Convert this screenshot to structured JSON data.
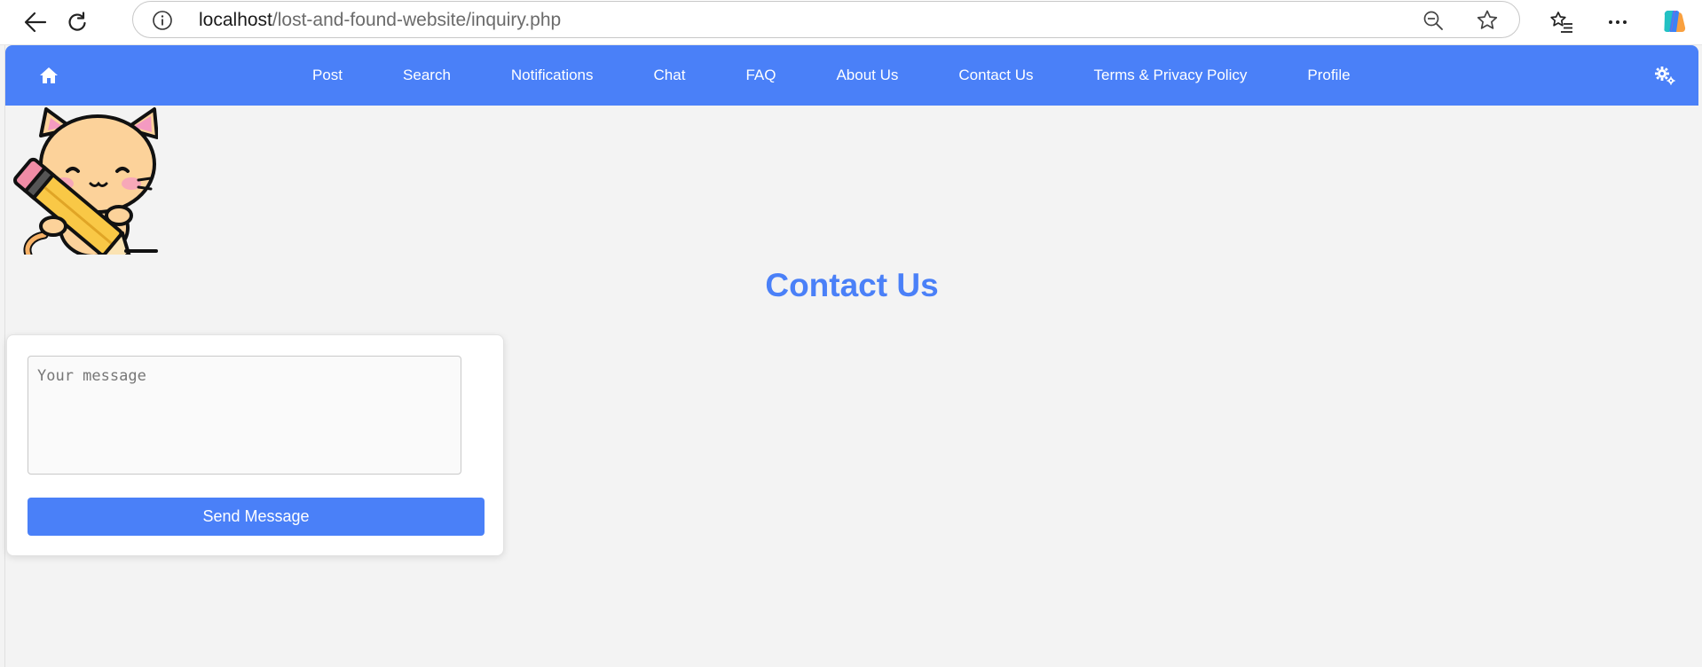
{
  "browser": {
    "url_host": "localhost",
    "url_path": "/lost-and-found-website/inquiry.php",
    "icons": [
      "back-arrow-icon",
      "refresh-icon",
      "info-icon",
      "zoom-out-icon",
      "favorite-star-icon",
      "favorites-list-icon",
      "more-options-icon",
      "copilot-icon"
    ]
  },
  "nav": {
    "home_icon": "home-icon",
    "items": [
      "Post",
      "Search",
      "Notifications",
      "Chat",
      "FAQ",
      "About Us",
      "Contact Us",
      "Terms & Privacy Policy",
      "Profile"
    ],
    "settings_icon": "gears-icon",
    "background_color": "#4a80f8"
  },
  "page": {
    "title": "Contact Us",
    "title_color": "#4a80f8",
    "mascot": "cat-with-pencil-illustration"
  },
  "form": {
    "message_placeholder": "Your message",
    "message_value": "",
    "send_label": "Send Message",
    "button_color": "#4a80f8"
  }
}
